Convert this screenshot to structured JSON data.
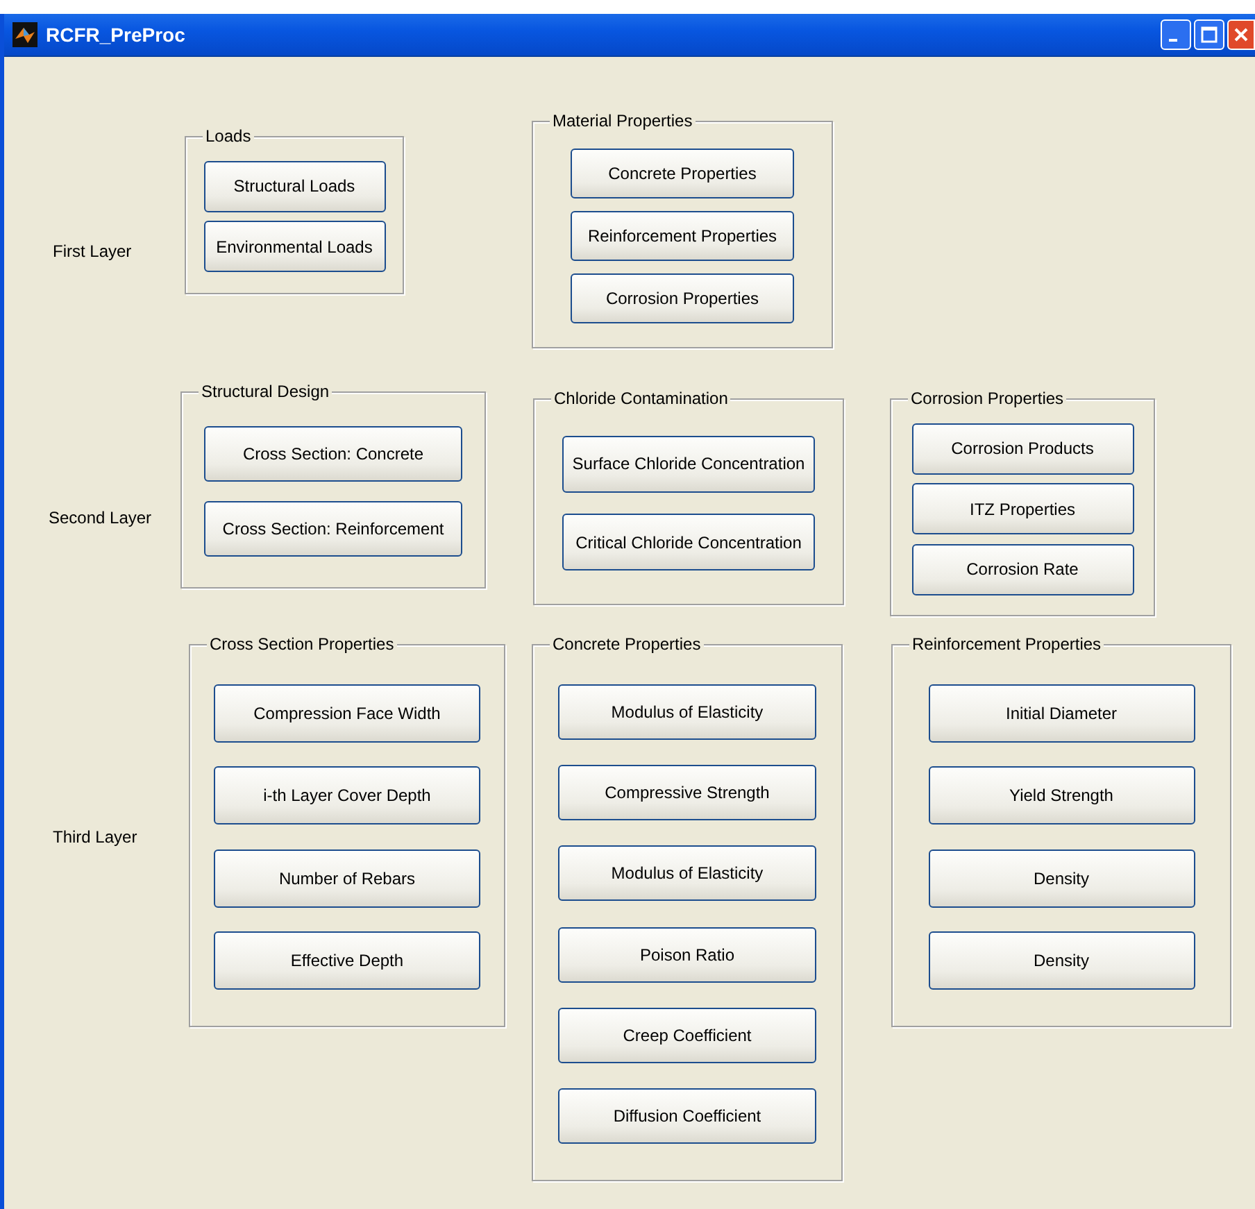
{
  "window": {
    "title": "RCFR_PreProc"
  },
  "layers": [
    {
      "label": "First Layer",
      "panels": [
        {
          "title": "Loads",
          "buttons": [
            "Structural Loads",
            "Environmental Loads"
          ]
        },
        {
          "title": "Material Properties",
          "buttons": [
            "Concrete Properties",
            "Reinforcement Properties",
            "Corrosion Properties"
          ]
        }
      ]
    },
    {
      "label": "Second Layer",
      "panels": [
        {
          "title": "Structural Design",
          "buttons": [
            "Cross Section: Concrete",
            "Cross Section: Reinforcement"
          ]
        },
        {
          "title": "Chloride Contamination",
          "buttons": [
            "Surface Chloride Concentration",
            "Critical Chloride Concentration"
          ]
        },
        {
          "title": "Corrosion  Properties",
          "buttons": [
            "Corrosion Products",
            "ITZ Properties",
            "Corrosion Rate"
          ]
        }
      ]
    },
    {
      "label": "Third Layer",
      "panels": [
        {
          "title": "Cross Section Properties",
          "buttons": [
            "Compression Face Width",
            "i-th Layer Cover Depth",
            "Number of Rebars",
            "Effective Depth"
          ]
        },
        {
          "title": "Concrete Properties",
          "buttons": [
            "Modulus of Elasticity",
            "Compressive Strength",
            "Modulus of Elasticity",
            "Poison Ratio",
            "Creep Coefficient",
            "Diffusion Coefficient"
          ]
        },
        {
          "title": "Reinforcement Properties",
          "buttons": [
            "Initial Diameter",
            "Yield Strength",
            "Density",
            "Density"
          ]
        }
      ]
    }
  ]
}
